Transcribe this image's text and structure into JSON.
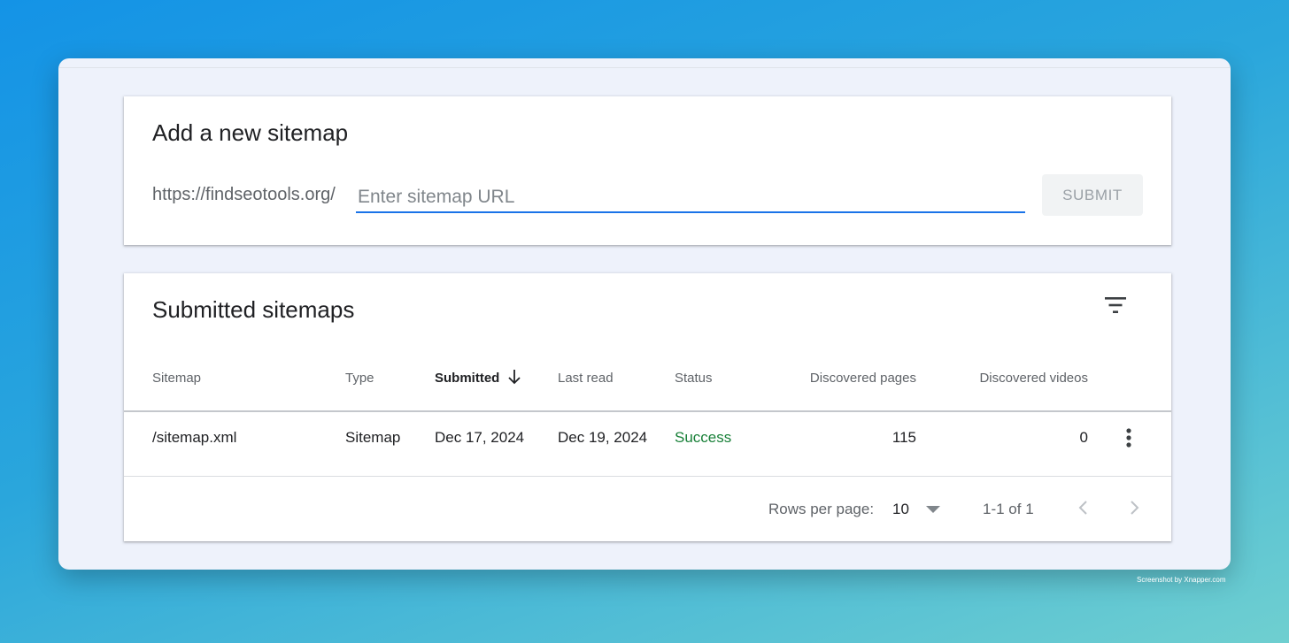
{
  "add_card": {
    "title": "Add a new sitemap",
    "url_prefix": "https://findseotools.org/",
    "input_placeholder": "Enter sitemap URL",
    "input_value": "",
    "submit_label": "SUBMIT"
  },
  "submitted_card": {
    "title": "Submitted sitemaps",
    "filter_icon": "filter-list-icon",
    "columns": [
      "Sitemap",
      "Type",
      "Submitted",
      "Last read",
      "Status",
      "Discovered pages",
      "Discovered videos"
    ],
    "sorted_column": "Submitted",
    "sort_direction": "descending",
    "rows": [
      {
        "sitemap": "/sitemap.xml",
        "type": "Sitemap",
        "submitted": "Dec 17, 2024",
        "last_read": "Dec 19, 2024",
        "status": "Success",
        "discovered_pages": "115",
        "discovered_videos": "0"
      }
    ],
    "pagination": {
      "rows_per_page_label": "Rows per page:",
      "rows_per_page_value": "10",
      "range_label": "1-1 of 1"
    }
  },
  "colors": {
    "accent": "#1a73e8",
    "success": "#188038",
    "card_background": "#ffffff",
    "window_background": "#eef2fb"
  },
  "watermark": "Screenshot by Xnapper.com"
}
